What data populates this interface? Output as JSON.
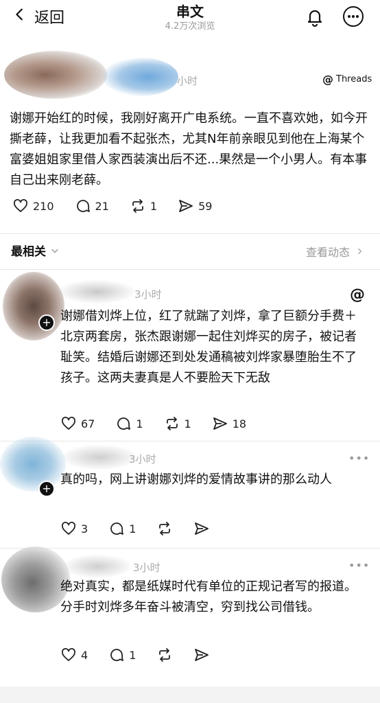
{
  "header": {
    "back_label": "返回",
    "title": "串文",
    "views": "4.2万次浏览"
  },
  "post": {
    "time": "小时",
    "platform": "Threads",
    "text": "谢娜开始红的时候，我刚好离开广电系统。一直不喜欢她，如今开撕老薛，让我更加看不起张杰，尤其N年前亲眼见到他在上海某个富婆姐姐家里借人家西装演出后不还...果然是一个小男人。有本事自己出来刚老薛。",
    "likes": "210",
    "comments": "21",
    "reposts": "1",
    "shares": "59"
  },
  "sort": {
    "label": "最相关",
    "activity": "查看动态"
  },
  "comments": [
    {
      "time": "3小时",
      "text": "谢娜借刘烨上位，红了就踹了刘烨，拿了巨额分手费＋北京两套房，张杰跟谢娜一起住刘烨买的房子，被记者耻笑。结婚后谢娜还到处发通稿被刘烨家暴堕胎生不了孩子。这两夫妻真是人不要脸天下无敌",
      "likes": "67",
      "comments": "1",
      "reposts": "1",
      "shares": "18"
    },
    {
      "time": "3小时",
      "text": "真的吗，网上讲谢娜刘烨的爱情故事讲的那么动人",
      "likes": "3",
      "comments": "1"
    },
    {
      "time": "3小时",
      "text": "绝对真实，都是纸媒时代有单位的正规记者写的报道。分手时刘烨多年奋斗被清空，穷到找公司借钱。",
      "likes": "4",
      "comments": "1"
    }
  ],
  "colors": {
    "text": "#111111",
    "muted": "#999999",
    "divider": "#e6e6e6"
  }
}
